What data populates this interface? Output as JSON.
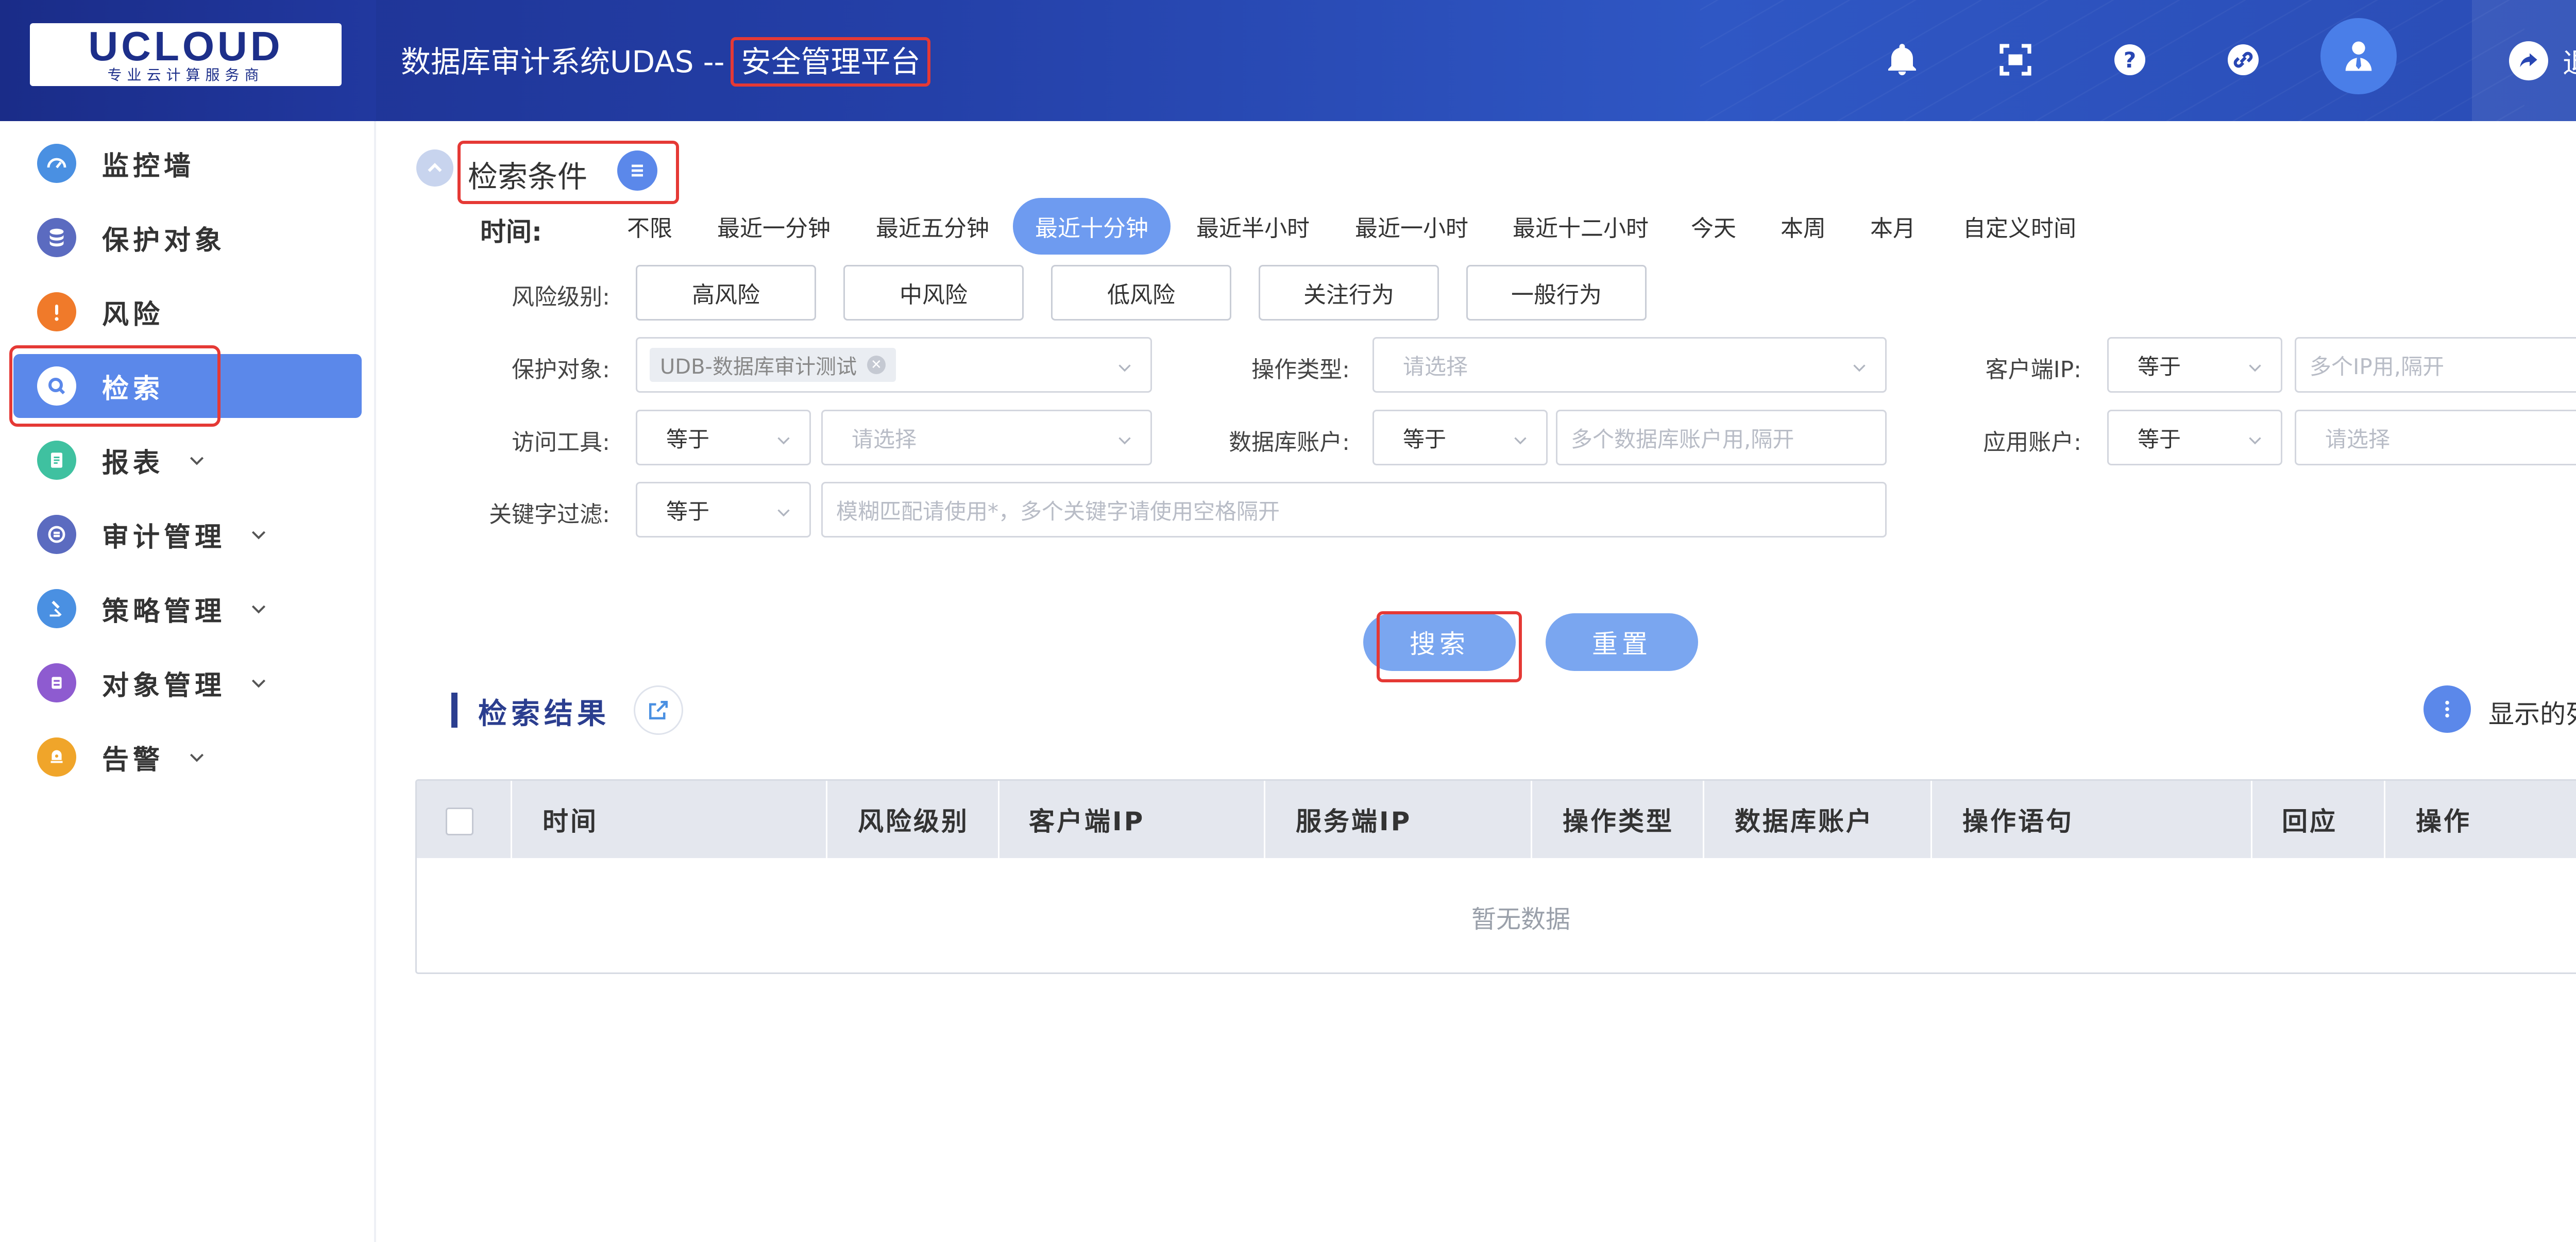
{
  "header": {
    "logo_text": "UCLOUD",
    "logo_sub": "专业云计算服务商",
    "title_main": "数据库审计系统UDAS",
    "title_sep": "--",
    "title_highlight": "安全管理平台",
    "icons": [
      "bell-icon",
      "fullscreen-icon",
      "help-icon",
      "link-icon",
      "user-avatar-icon"
    ],
    "logout_label": "退出"
  },
  "sidebar": {
    "items": [
      {
        "label": "监控墙",
        "icon": "dashboard-icon",
        "color": "#4a90e2"
      },
      {
        "label": "保护对象",
        "icon": "database-icon",
        "color": "#5b6bc0"
      },
      {
        "label": "风险",
        "icon": "alert-icon",
        "color": "#f07a2a"
      },
      {
        "label": "检索",
        "icon": "search-icon",
        "color": "#ffffff"
      },
      {
        "label": "报表",
        "icon": "report-icon",
        "color": "#3fc1a0"
      },
      {
        "label": "审计管理",
        "icon": "audit-icon",
        "color": "#5b6bc0"
      },
      {
        "label": "策略管理",
        "icon": "policy-icon",
        "color": "#4a90e2"
      },
      {
        "label": "对象管理",
        "icon": "object-icon",
        "color": "#8e5bd0"
      },
      {
        "label": "告警",
        "icon": "alarm-icon",
        "color": "#f0a52a"
      }
    ],
    "active_index": 3
  },
  "search": {
    "title": "检索条件",
    "time_label": "时间:",
    "time_options": [
      "不限",
      "最近一分钟",
      "最近五分钟",
      "最近十分钟",
      "最近半小时",
      "最近一小时",
      "最近十二小时",
      "今天",
      "本周",
      "本月",
      "自定义时间"
    ],
    "time_selected": "最近十分钟",
    "risk_label": "风险级别:",
    "risk_options": [
      "高风险",
      "中风险",
      "低风险",
      "关注行为",
      "一般行为"
    ],
    "protect_label": "保护对象:",
    "protect_tag": "UDB-数据库审计测试",
    "op_type_label": "操作类型:",
    "op_type_placeholder": "请选择",
    "client_ip_label": "客户端IP:",
    "client_ip_op": "等于",
    "client_ip_placeholder": "多个IP用,隔开",
    "tool_label": "访问工具:",
    "tool_op": "等于",
    "tool_placeholder": "请选择",
    "db_account_label": "数据库账户:",
    "db_account_op": "等于",
    "db_account_placeholder": "多个数据库账户用,隔开",
    "app_account_label": "应用账户:",
    "app_account_op": "等于",
    "app_account_placeholder": "请选择",
    "keyword_label": "关键字过滤:",
    "keyword_op": "等于",
    "keyword_placeholder": "模糊匹配请使用*，多个关键字请使用空格隔开",
    "search_button": "搜索",
    "reset_button": "重置"
  },
  "results": {
    "title": "检索结果",
    "columns_button": "显示的列",
    "columns": [
      "时间",
      "风险级别",
      "客户端IP",
      "服务端IP",
      "操作类型",
      "数据库账户",
      "操作语句",
      "回应",
      "操作"
    ],
    "empty_text": "暂无数据"
  }
}
